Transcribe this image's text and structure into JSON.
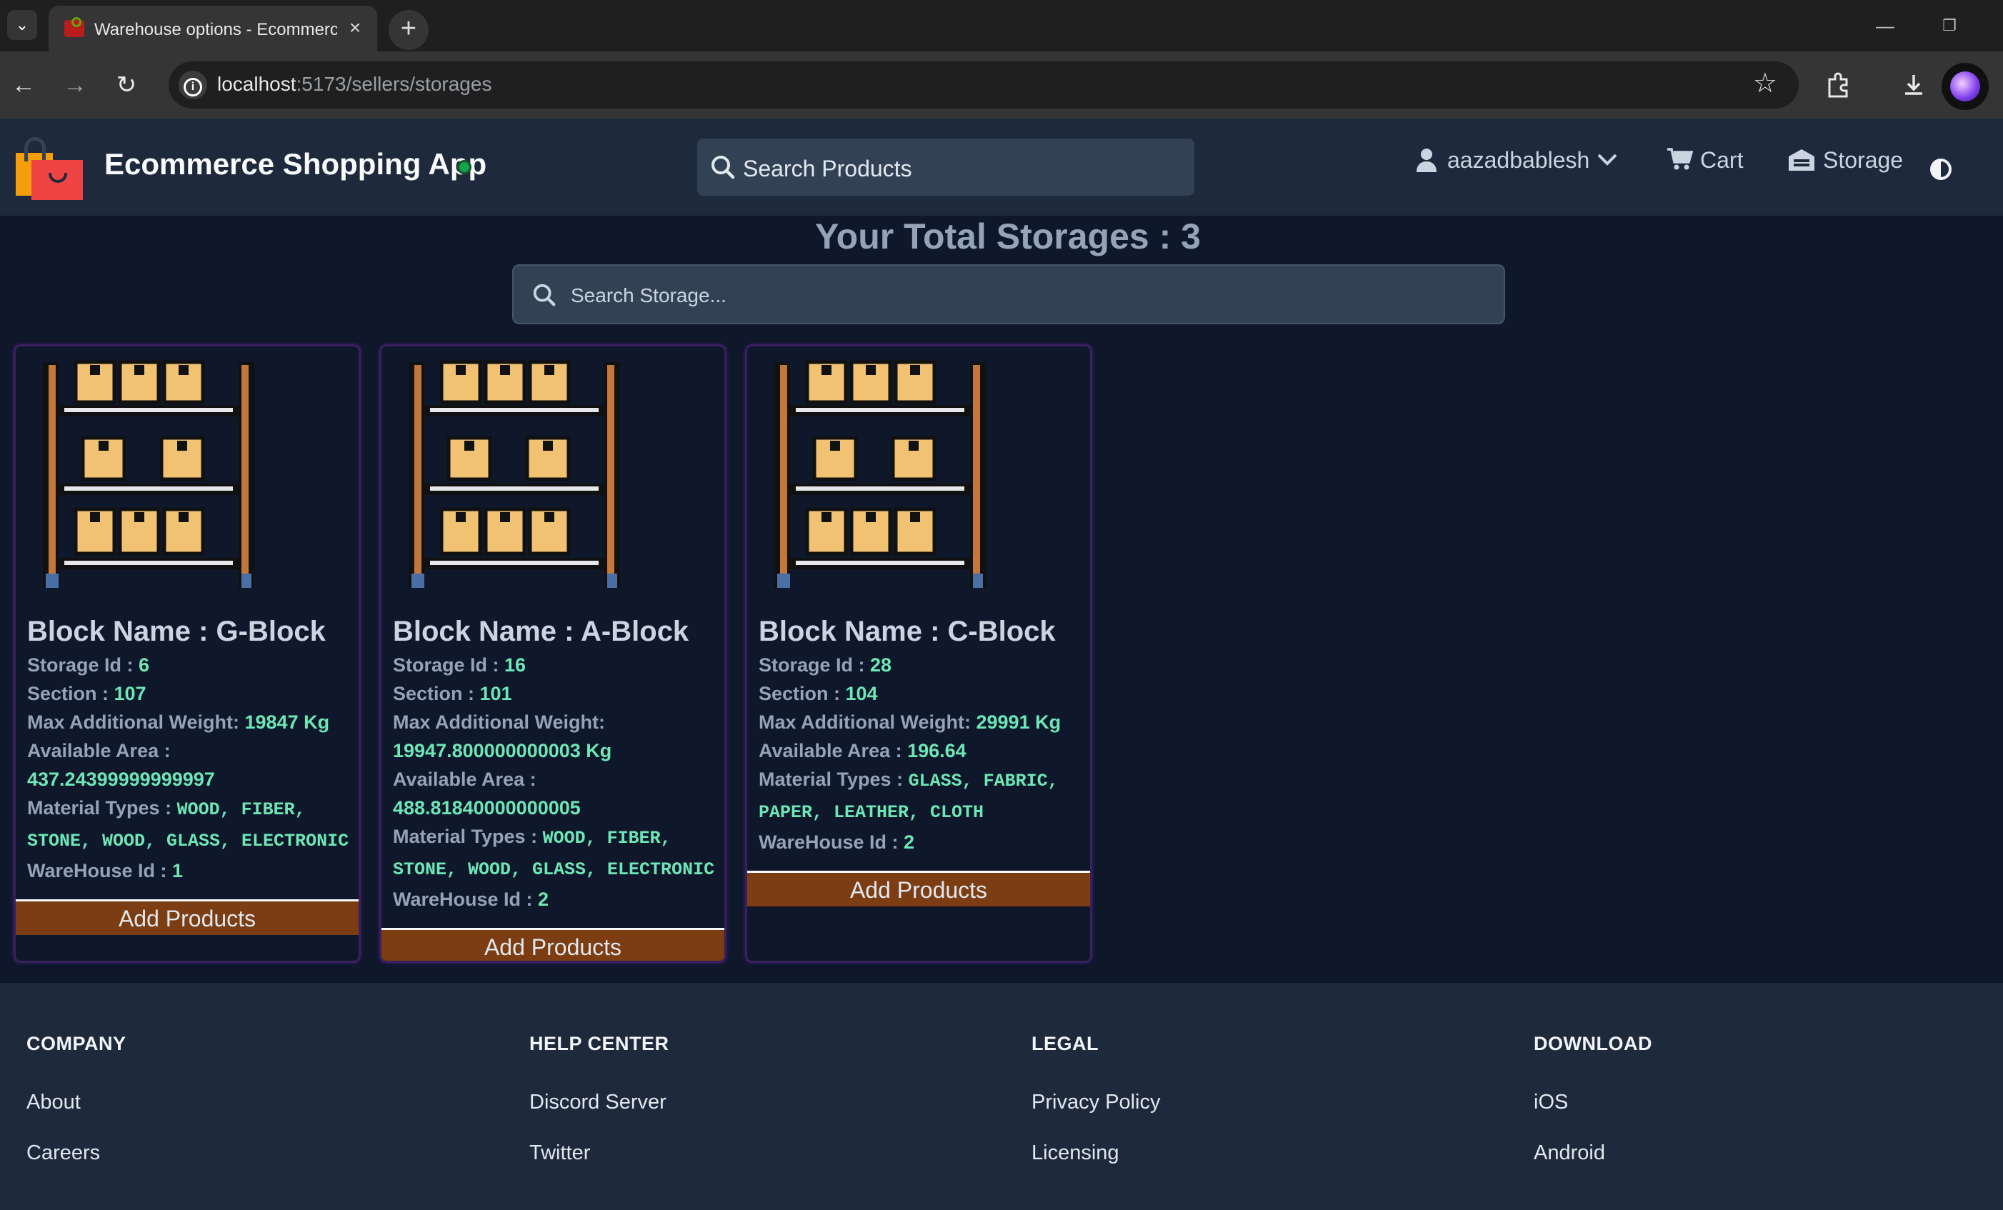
{
  "browser": {
    "tab_title": "Warehouse options - Ecommerce Shopping App",
    "url_host": "localhost",
    "url_rest": ":5173/sellers/storages"
  },
  "header": {
    "brand": "Ecommerce Shopping App",
    "search_placeholder": "Search Products",
    "username": "aazadbablesh",
    "cart_label": "Cart",
    "storage_label": "Storage"
  },
  "main": {
    "title": "Your Total Storages : 3",
    "search_placeholder": "Search Storage..."
  },
  "labels": {
    "block_name": "Block Name : ",
    "storage_id": "Storage Id : ",
    "section": "Section : ",
    "max_weight": "Max Additional Weight: ",
    "available_area": "Available Area : ",
    "material_types": "Material Types : ",
    "warehouse_id": "WareHouse Id : ",
    "add_products": "Add Products"
  },
  "storages": [
    {
      "block": "G-Block",
      "storage_id": "6",
      "section": "107",
      "max_weight": "19847 Kg",
      "available_area": "437.24399999999997",
      "materials_line1": "WOOD, FIBER,",
      "materials_line2": "STONE, WOOD, GLASS, ELECTRONIC",
      "warehouse_id": "1"
    },
    {
      "block": "A-Block",
      "storage_id": "16",
      "section": "101",
      "max_weight": "19947.800000000003 Kg",
      "available_area": "488.81840000000005",
      "materials_line1": "WOOD, FIBER,",
      "materials_line2": "STONE, WOOD, GLASS, ELECTRONIC",
      "warehouse_id": "2"
    },
    {
      "block": "C-Block",
      "storage_id": "28",
      "section": "104",
      "max_weight": "29991 Kg",
      "available_area": "196.64",
      "materials_line1": "GLASS, FABRIC,",
      "materials_line2": "PAPER, LEATHER, CLOTH",
      "warehouse_id": "2"
    }
  ],
  "footer": {
    "columns": [
      {
        "heading": "COMPANY",
        "links": [
          "About",
          "Careers"
        ]
      },
      {
        "heading": "HELP CENTER",
        "links": [
          "Discord Server",
          "Twitter"
        ]
      },
      {
        "heading": "LEGAL",
        "links": [
          "Privacy Policy",
          "Licensing"
        ]
      },
      {
        "heading": "DOWNLOAD",
        "links": [
          "iOS",
          "Android"
        ]
      }
    ]
  }
}
